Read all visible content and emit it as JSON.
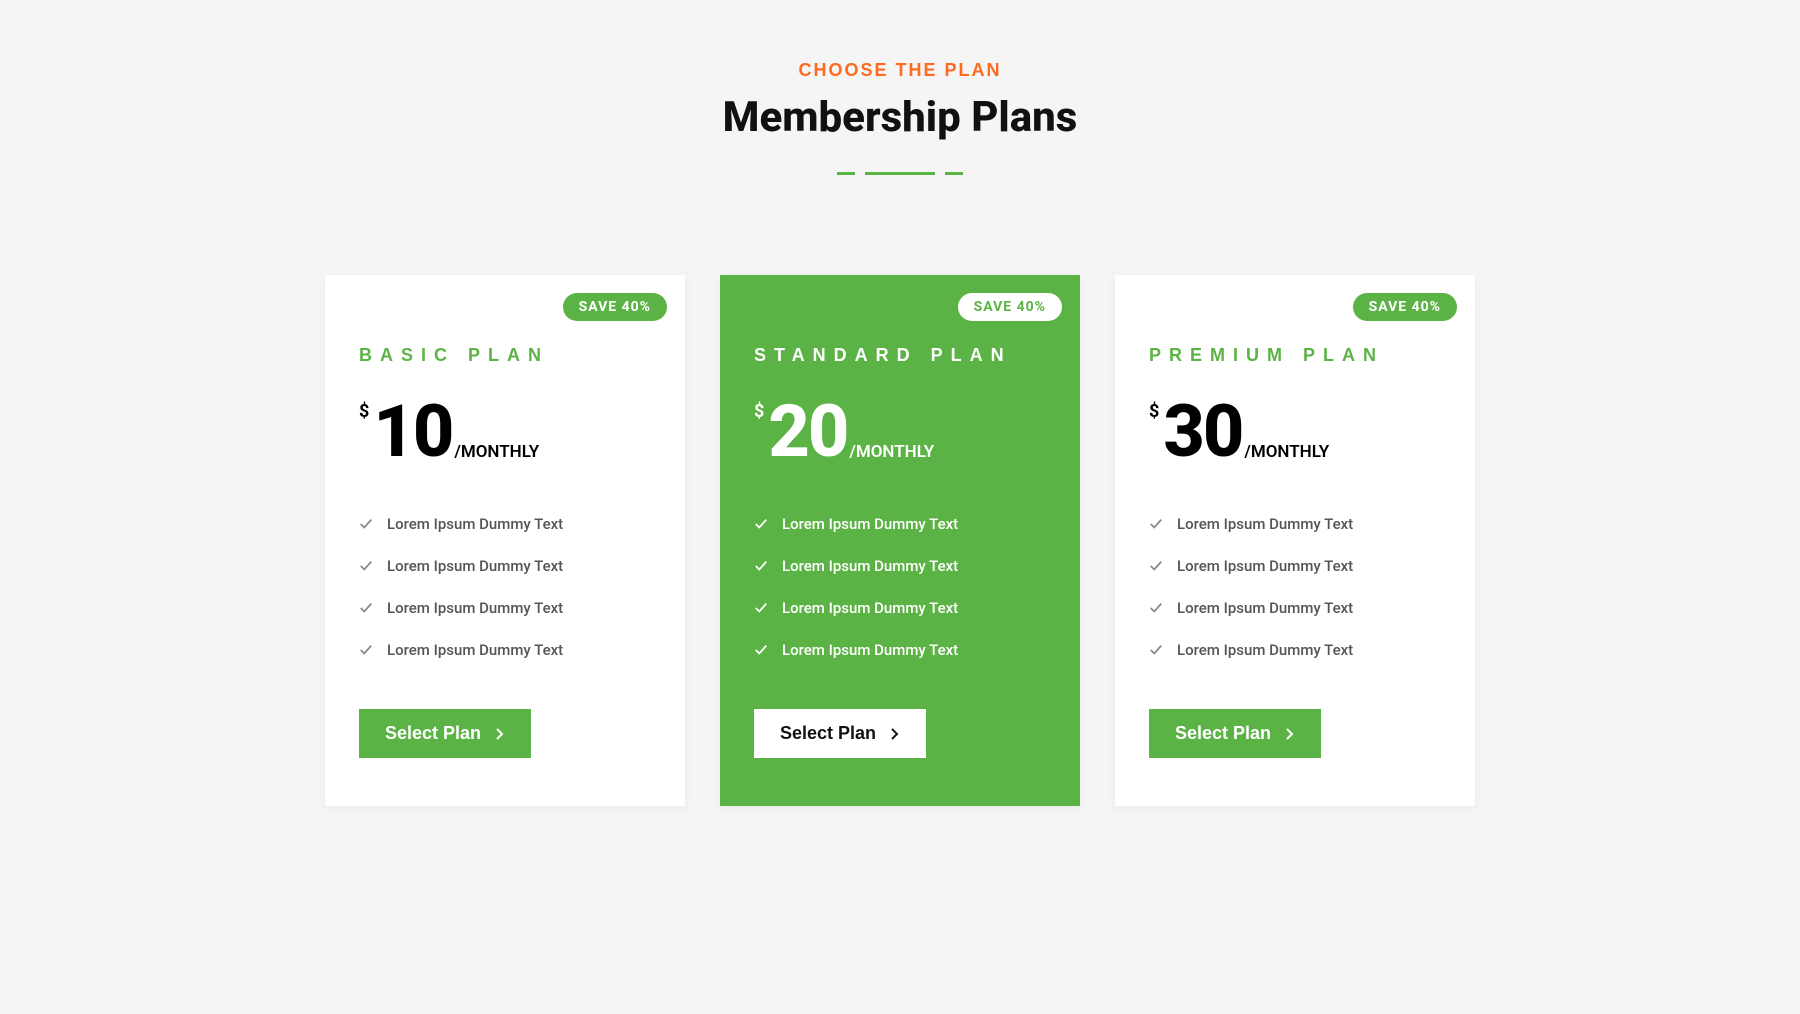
{
  "header": {
    "eyebrow": "CHOOSE THE PLAN",
    "title": "Membership Plans"
  },
  "plans": [
    {
      "badge": "SAVE 40%",
      "name": "BASIC PLAN",
      "currency": "$",
      "price": "10",
      "period": "/MONTHLY",
      "features": [
        "Lorem Ipsum Dummy Text",
        "Lorem Ipsum Dummy Text",
        "Lorem Ipsum Dummy Text",
        "Lorem Ipsum Dummy Text"
      ],
      "button": "Select Plan"
    },
    {
      "badge": "SAVE 40%",
      "name": "STANDARD PLAN",
      "currency": "$",
      "price": "20",
      "period": "/MONTHLY",
      "features": [
        "Lorem Ipsum Dummy Text",
        "Lorem Ipsum Dummy Text",
        "Lorem Ipsum Dummy Text",
        "Lorem Ipsum Dummy Text"
      ],
      "button": "Select Plan"
    },
    {
      "badge": "SAVE 40%",
      "name": "PREMIUM PLAN",
      "currency": "$",
      "price": "30",
      "period": "/MONTHLY",
      "features": [
        "Lorem Ipsum Dummy Text",
        "Lorem Ipsum Dummy Text",
        "Lorem Ipsum Dummy Text",
        "Lorem Ipsum Dummy Text"
      ],
      "button": "Select Plan"
    }
  ]
}
